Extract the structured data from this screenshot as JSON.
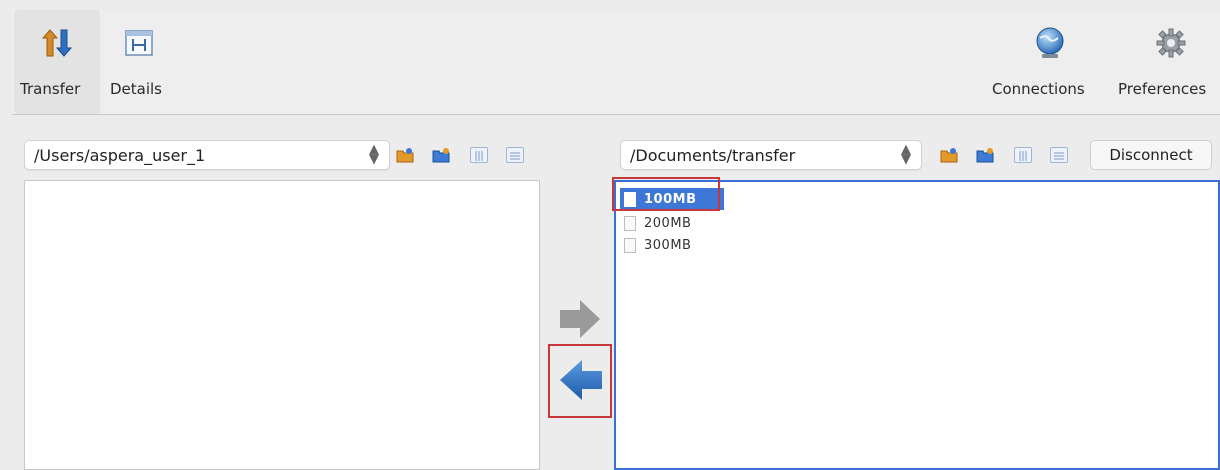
{
  "toolbar": {
    "transfer_label": "Transfer",
    "details_label": "Details",
    "connections_label": "Connections",
    "preferences_label": "Preferences"
  },
  "local": {
    "path": "/Users/aspera_user_1",
    "files": []
  },
  "remote": {
    "path": "/Documents/transfer",
    "disconnect_label": "Disconnect",
    "files": [
      "100MB",
      "200MB",
      "300MB"
    ],
    "selected": "100MB"
  },
  "colors": {
    "selection": "#3d78d8",
    "focus_border": "#3b6fd8",
    "highlight": "#c8373c",
    "arrow_active": "#2e6fc0",
    "arrow_inactive": "#9a9a9a"
  },
  "icons": {
    "transfer": "transfer-arrows-icon",
    "details": "details-icon",
    "connections": "globe-icon",
    "preferences": "gear-icon",
    "upload_arrow": "arrow-right-icon",
    "download_arrow": "arrow-left-icon"
  }
}
